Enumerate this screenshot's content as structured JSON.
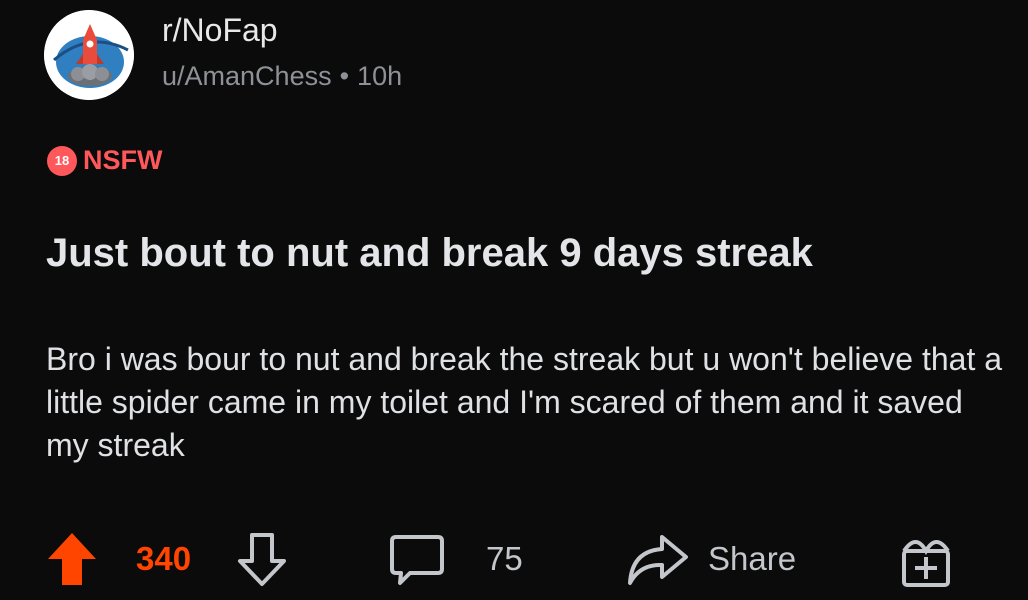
{
  "post": {
    "subreddit": "r/NoFap",
    "author": "u/AmanChess",
    "separator": "•",
    "time": "10h",
    "nsfw_badge": "18",
    "nsfw_label": "NSFW",
    "title": "Just bout to nut and break 9 days streak",
    "body": "Bro i was bour to nut and break the streak but u won't believe that a little spider came in my toilet and I'm scared of them and it saved my streak"
  },
  "actions": {
    "upvotes": "340",
    "comments": "75",
    "share_label": "Share"
  },
  "colors": {
    "background": "#0b0b0c",
    "upvote": "#ff4500",
    "nsfw": "#ff585b",
    "meta_gray": "#8e9196"
  },
  "icons": {
    "avatar": "rocket-logo",
    "upvote": "upvote-arrow-icon",
    "downvote": "downvote-arrow-icon",
    "comment": "comment-bubble-icon",
    "share": "share-arrow-icon",
    "award": "gift-award-icon"
  }
}
